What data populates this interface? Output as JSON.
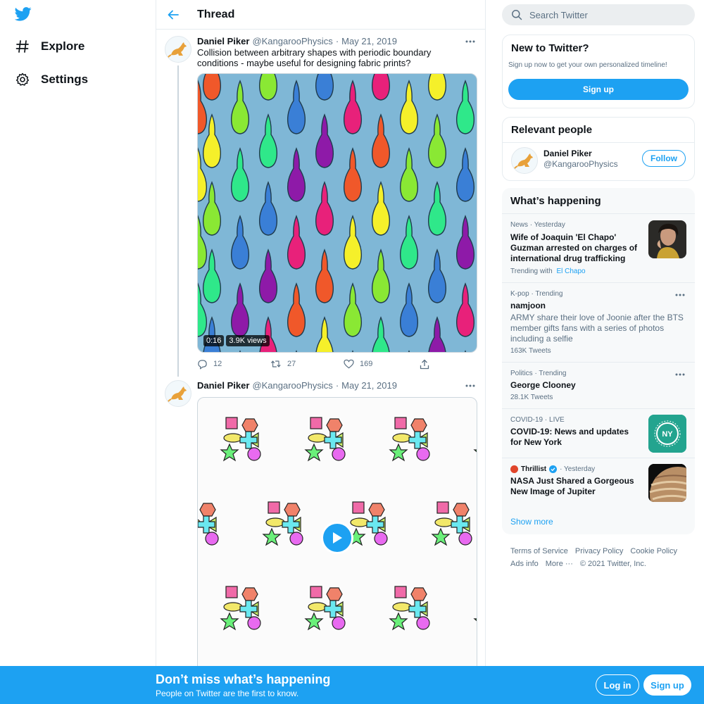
{
  "nav": {
    "items": [
      {
        "label": "Explore",
        "icon": "hashtag-icon"
      },
      {
        "label": "Settings",
        "icon": "gear-icon"
      }
    ]
  },
  "header": {
    "title": "Thread"
  },
  "tweets": [
    {
      "name": "Daniel Piker",
      "handle": "@KangarooPhysics",
      "dot": "·",
      "date": "May 21, 2019",
      "text": "Collision between arbitrary shapes with periodic boundary conditions - maybe useful for designing fabric prints?",
      "media": {
        "duration": "0:16",
        "views": "3.9K views"
      },
      "replies": "12",
      "retweets": "27",
      "likes": "169"
    },
    {
      "name": "Daniel Piker",
      "handle": "@KangarooPhysics",
      "dot": "·",
      "date": "May 21, 2019"
    }
  ],
  "search": {
    "placeholder": "Search Twitter"
  },
  "signup_card": {
    "title": "New to Twitter?",
    "subtitle": "Sign up now to get your own personalized timeline!",
    "button": "Sign up"
  },
  "people_card": {
    "title": "Relevant people",
    "name": "Daniel Piker",
    "handle": "@KangarooPhysics",
    "follow": "Follow"
  },
  "trends": {
    "title": "What’s happening",
    "items": [
      {
        "meta": "News · Yesterday",
        "title": "Wife of Joaquin 'El Chapo' Guzman arrested on charges of international drug trafficking",
        "extra_prefix": "Trending with",
        "extra_link": "El Chapo"
      },
      {
        "meta": "K-pop · Trending",
        "title": "namjoon",
        "desc": "ARMY share their love of Joonie after the BTS member gifts fans with a series of photos including a selfie",
        "count": "163K Tweets"
      },
      {
        "meta": "Politics · Trending",
        "title": "George Clooney",
        "count": "28.1K Tweets"
      },
      {
        "meta": "COVID-19 · LIVE",
        "title": "COVID-19: News and updates for New York",
        "thumb_text": "NY"
      },
      {
        "meta_source": "Thrillist",
        "meta_time": "· Yesterday",
        "title": "NASA Just Shared a Gorgeous New Image of Jupiter"
      }
    ],
    "show_more": "Show more"
  },
  "footer": {
    "links": [
      "Terms of Service",
      "Privacy Policy",
      "Cookie Policy",
      "Ads info",
      "More ···",
      "© 2021 Twitter, Inc."
    ]
  },
  "bottom_bar": {
    "title": "Don’t miss what’s happening",
    "subtitle": "People on Twitter are the first to know.",
    "login": "Log in",
    "signup": "Sign up"
  },
  "colors": {
    "accent": "#1da1f2",
    "text": "#0f1419",
    "muted": "#5b7083",
    "border": "#e6ecf0"
  }
}
